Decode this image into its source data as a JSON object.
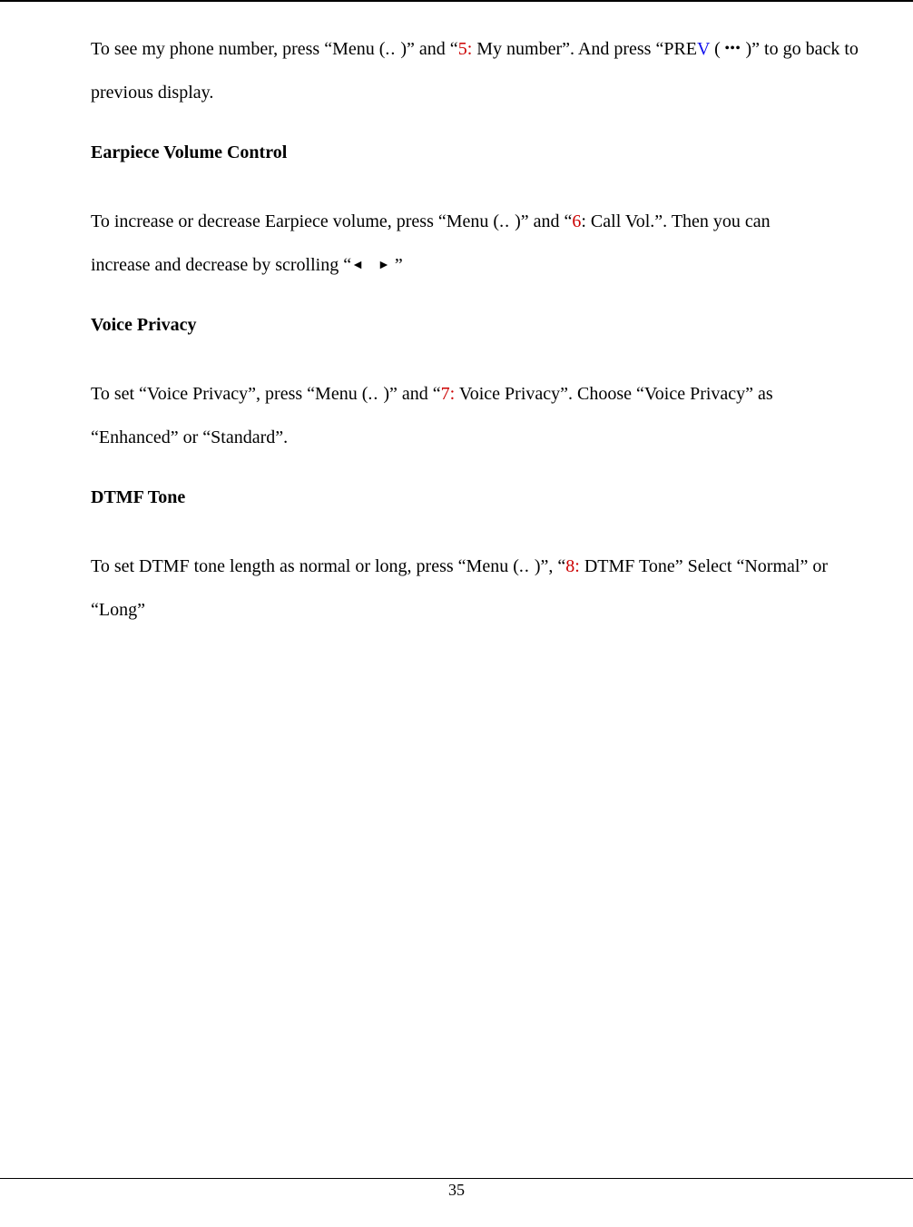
{
  "p1_a": "To see my phone number, press “Menu (",
  "p1_b": ")” and “",
  "p1_num": "5:",
  "p1_c": " My number”. And press “PRE",
  "p1_v": "V",
  "p1_d": " (",
  "p1_e": ")” to go back to previous display.",
  "h2": "Earpiece Volume Control",
  "p2_a": "To increase or decrease Earpiece volume, press “Menu (",
  "p2_b": ")” and “",
  "p2_num": "6",
  "p2_c": ": Call Vol.”. Then you can",
  "p2_d": "increase and decrease by scrolling “",
  "p2_e": "”",
  "h3": "Voice Privacy",
  "p3_a": "To set “Voice Privacy”, press “Menu (",
  "p3_b": ")” and “",
  "p3_num": "7:",
  "p3_c": " Voice Privacy”. Choose “Voice Privacy” as “Enhanced” or “Standard”.",
  "h4": "DTMF Tone",
  "p4_a": "To set DTMF tone length as normal or long, press “Menu (",
  "p4_b": ")”, “",
  "p4_num": "8:",
  "p4_c": " DTMF Tone” Select “Normal” or “Long”",
  "menu_dots": "..",
  "prev_dots": "•••",
  "arrow_left": "◄",
  "arrow_right": "►",
  "page_number": "35"
}
